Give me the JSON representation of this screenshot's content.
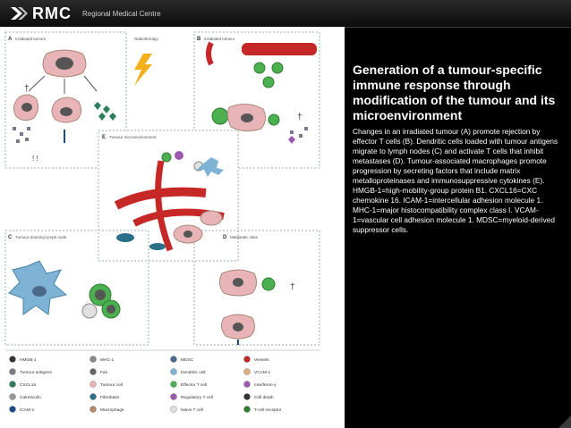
{
  "header": {
    "logo_text": "RMC",
    "logo_subtext": "Regional Medical Centre"
  },
  "figure": {
    "panels": {
      "a": {
        "letter": "A",
        "title": "Irradiated tumour"
      },
      "radiotherapy": "Radiotherapy",
      "b": {
        "letter": "B",
        "title": "Irradiated tumour"
      },
      "e": {
        "letter": "E",
        "title": "Tumour microenvironment"
      },
      "c": {
        "letter": "C",
        "title": "Tumour-draining lymph node"
      },
      "d": {
        "letter": "D",
        "title": "Metastatic sites"
      }
    },
    "legend": [
      {
        "label": "HMGB-1",
        "icon": "exclamation-icon"
      },
      {
        "label": "Tumour antigens",
        "icon": "antigen-icon"
      },
      {
        "label": "CXCL16",
        "icon": "heart-icon"
      },
      {
        "label": "Calreticulin",
        "icon": "calreticulin-icon"
      },
      {
        "label": "ICAM-1",
        "icon": "receptor-icon"
      },
      {
        "label": "MHC-1",
        "icon": "mhc-icon"
      },
      {
        "label": "Fas",
        "icon": "fas-icon"
      },
      {
        "label": "Tumour cell",
        "icon": "tumour-cell-icon"
      },
      {
        "label": "Fibroblast",
        "icon": "fibroblast-icon"
      },
      {
        "label": "Macrophage",
        "icon": "macrophage-icon"
      },
      {
        "label": "MDSC",
        "icon": "mdsc-icon"
      },
      {
        "label": "Dendritic cell",
        "icon": "dendritic-cell-icon"
      },
      {
        "label": "Effector T cell",
        "icon": "effector-t-cell-icon"
      },
      {
        "label": "Regulatory T cell",
        "icon": "regulatory-t-cell-icon"
      },
      {
        "label": "Naive T cell",
        "icon": "naive-t-cell-icon"
      },
      {
        "label": "Vessels",
        "icon": "vessel-icon"
      },
      {
        "label": "VCAM-1",
        "icon": "vcam-icon"
      },
      {
        "label": "Interferon-γ",
        "icon": "interferon-icon"
      },
      {
        "label": "Cell death",
        "icon": "cross-icon"
      },
      {
        "label": "T-cell receptor",
        "icon": "tcr-icon"
      }
    ]
  },
  "caption": {
    "title": "Generation of a tumour-specific immune response through modification of the tumour and its microenvironment",
    "body": "Changes in an irradiated tumour (A) promote rejection by effector T cells (B). Dendritic cells loaded with tumour antigens migrate to lymph nodes (C) and activate T cells that inhibit metastases (D). Tumour-associated macrophages promote progression by secreting factors that include matrix metalloproteinases and immunosuppressive cytokines (E). HMGB-1=high-mobility-group protein B1. CXCL16=CXC chemokine 16. ICAM-1=intercellular adhesion molecule 1. MHC-1=major histocompatibility complex class I. VCAM-1=vascular cell adhesion molecule 1. MDSC=myeloid-derived suppressor cells."
  },
  "colors": {
    "background": "#000000",
    "tumour_cell": "#e8b4b8",
    "effector_t_cell": "#4caf50",
    "vessel": "#c62828",
    "dendritic_cell": "#7fb3d5",
    "lightning": "#f2b11b"
  }
}
